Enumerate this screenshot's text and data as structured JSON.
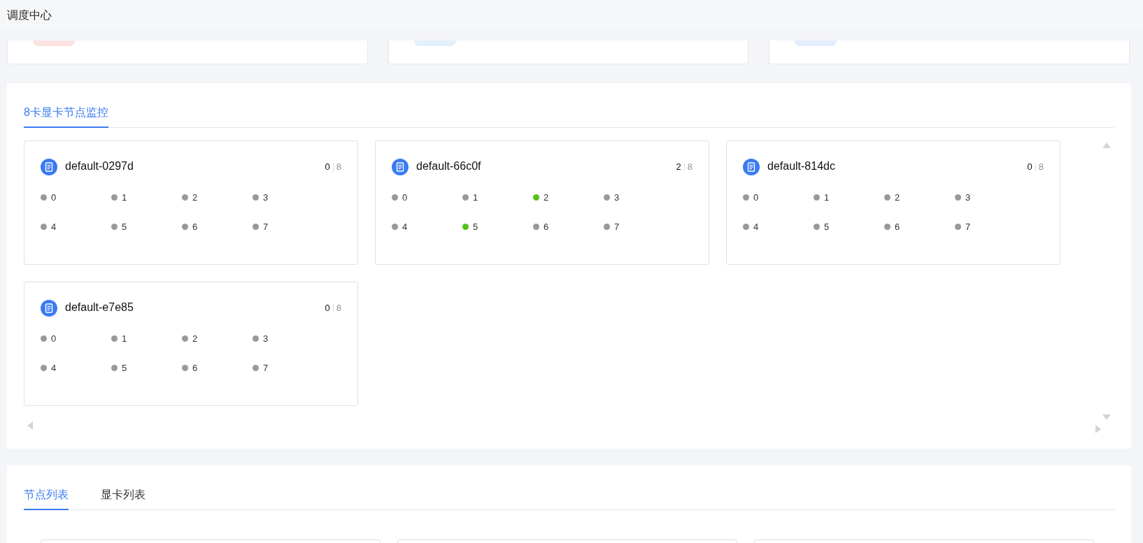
{
  "page_title": "调度中心",
  "stat_cards": [
    {
      "color": "#fde2e2"
    },
    {
      "color": "#e1f1fd"
    },
    {
      "color": "#e3edfd"
    }
  ],
  "monitor": {
    "tabs": [
      {
        "label": "8卡显卡节点监控",
        "selected": true
      }
    ],
    "nodes": [
      {
        "name": "default-0297d",
        "used": "0",
        "total": "8",
        "gpus": [
          {
            "label": "0",
            "active": false
          },
          {
            "label": "1",
            "active": false
          },
          {
            "label": "2",
            "active": false
          },
          {
            "label": "3",
            "active": false
          },
          {
            "label": "4",
            "active": false
          },
          {
            "label": "5",
            "active": false
          },
          {
            "label": "6",
            "active": false
          },
          {
            "label": "7",
            "active": false
          }
        ]
      },
      {
        "name": "default-66c0f",
        "used": "2",
        "total": "8",
        "gpus": [
          {
            "label": "0",
            "active": false
          },
          {
            "label": "1",
            "active": false
          },
          {
            "label": "2",
            "active": true
          },
          {
            "label": "3",
            "active": false
          },
          {
            "label": "4",
            "active": false
          },
          {
            "label": "5",
            "active": true
          },
          {
            "label": "6",
            "active": false
          },
          {
            "label": "7",
            "active": false
          }
        ]
      },
      {
        "name": "default-814dc",
        "used": "0",
        "total": "8",
        "gpus": [
          {
            "label": "0",
            "active": false
          },
          {
            "label": "1",
            "active": false
          },
          {
            "label": "2",
            "active": false
          },
          {
            "label": "3",
            "active": false
          },
          {
            "label": "4",
            "active": false
          },
          {
            "label": "5",
            "active": false
          },
          {
            "label": "6",
            "active": false
          },
          {
            "label": "7",
            "active": false
          }
        ]
      },
      {
        "name": "default-e7e85",
        "used": "0",
        "total": "8",
        "gpus": [
          {
            "label": "0",
            "active": false
          },
          {
            "label": "1",
            "active": false
          },
          {
            "label": "2",
            "active": false
          },
          {
            "label": "3",
            "active": false
          },
          {
            "label": "4",
            "active": false
          },
          {
            "label": "5",
            "active": false
          },
          {
            "label": "6",
            "active": false
          },
          {
            "label": "7",
            "active": false
          }
        ]
      }
    ]
  },
  "lists": {
    "tabs": [
      {
        "label": "节点列表",
        "selected": true
      },
      {
        "label": "显卡列表",
        "selected": false
      }
    ]
  }
}
